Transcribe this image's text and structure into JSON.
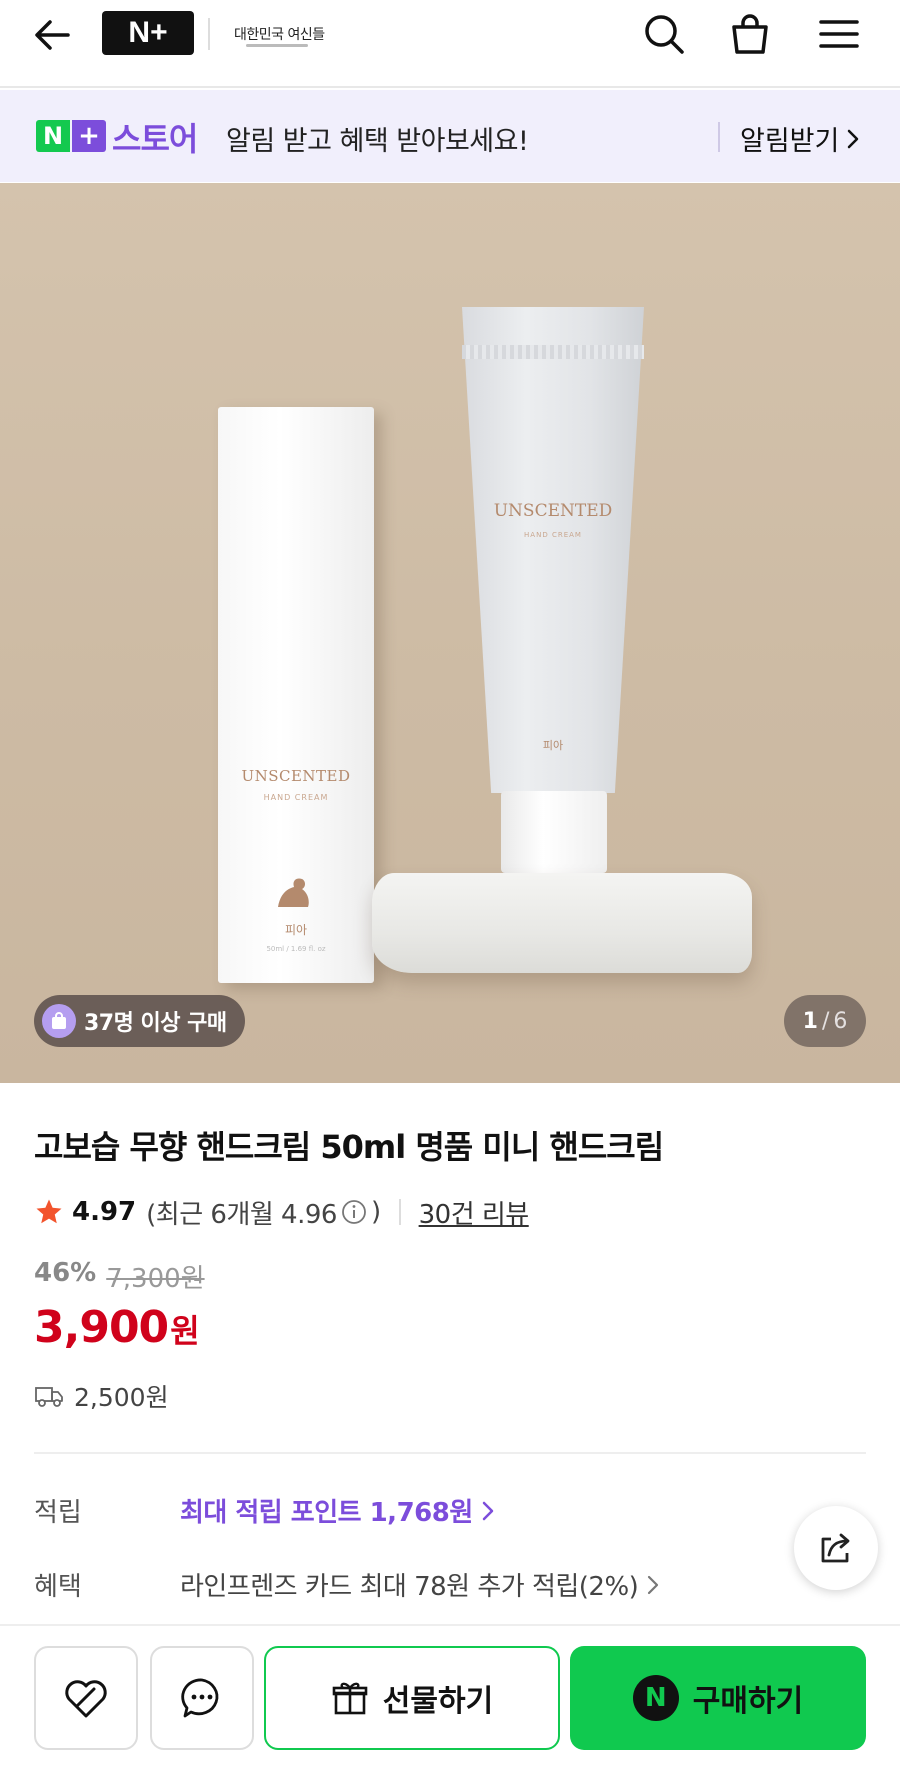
{
  "header": {
    "logo_text": "N+",
    "brand_logo_text": "대한민국 여신들",
    "icons": [
      "back-arrow-icon",
      "search-icon",
      "shopping-bag-icon",
      "menu-icon"
    ]
  },
  "store_banner": {
    "store_label": "스토어",
    "message": "알림 받고 혜택 받아보세요!",
    "cta": "알림받기"
  },
  "gallery": {
    "box_product_text": "UNSCENTED",
    "box_product_sub": "HAND CREAM",
    "box_maker": "피아",
    "box_volume": "50ml / 1.69 fl. oz",
    "tube_product_text": "UNSCENTED",
    "tube_product_sub": "HAND CREAM",
    "tube_maker": "피아",
    "purchase_badge": "37명 이상 구매",
    "counter_current": "1",
    "counter_sep": "/",
    "counter_total": "6"
  },
  "product": {
    "title": "고보습 무향 핸드크림 50ml 명품 미니 핸드크림",
    "rating": "4.97",
    "recent_rating_label": "(최근 6개월 4.96",
    "recent_rating_close": ")",
    "reviews": "30건 리뷰",
    "discount_pct": "46%",
    "original_price": "7,300원",
    "price": "3,900",
    "price_unit": "원",
    "shipping_fee": "2,500원"
  },
  "info": {
    "points_label": "적립",
    "points_value": "최대 적립 포인트 1,768원",
    "benefit_label": "혜택",
    "benefit_value": "라인프렌즈 카드 최대 78원 추가 적립(2%)"
  },
  "bottom_bar": {
    "gift_label": "선물하기",
    "buy_label": "구매하기",
    "buy_logo": "N"
  },
  "colors": {
    "accent_purple": "#7c4ddb",
    "naver_green": "#10c94f",
    "price_red": "#d0021b"
  }
}
